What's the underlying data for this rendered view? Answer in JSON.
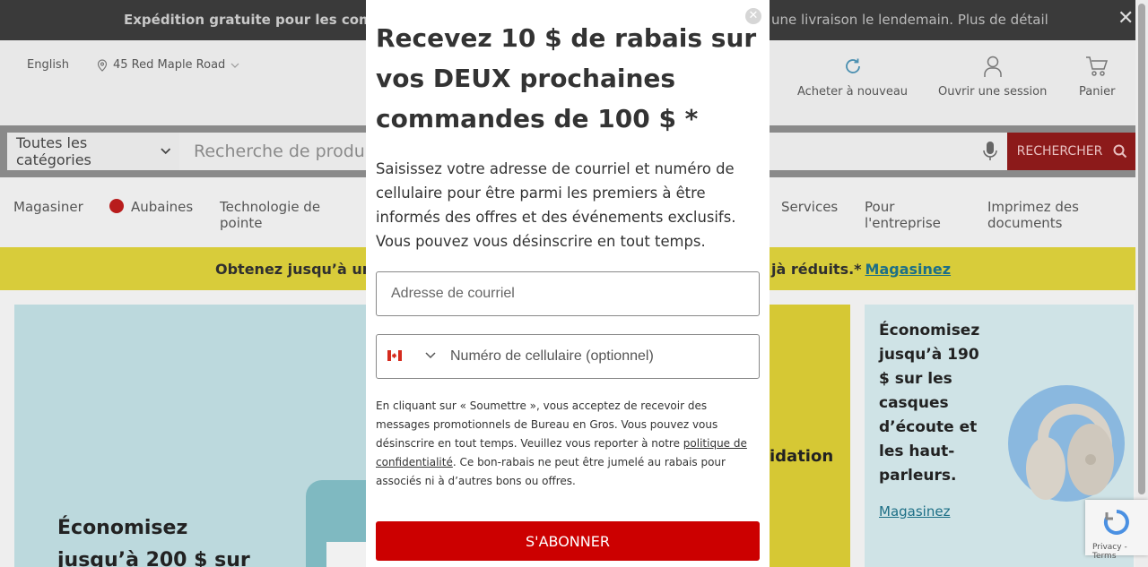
{
  "top_bar": {
    "left_text": "Expédition gratuite pour les comman",
    "right_text": "une livraison le lendemain. Plus de détail",
    "close_icon": "close-icon"
  },
  "header": {
    "language": "English",
    "address": "45 Red Maple Road",
    "reorder_label": "Acheter à nouveau",
    "signin_label": "Ouvrir une session",
    "cart_label": "Panier"
  },
  "search": {
    "category": "Toutes les catégories",
    "placeholder": "Recherche de produits",
    "button_label": "RECHERCHER"
  },
  "nav": {
    "items": [
      "Magasiner",
      "Aubaines",
      "Technologie de pointe",
      "Services",
      "Pour l'entreprise",
      "Imprimez des documents"
    ]
  },
  "promo_bar": {
    "left_text": "Obtenez jusqu’à un ra",
    "right_text": "jà réduits.*",
    "link": "Magasinez"
  },
  "cards": {
    "card1_title": "Économisez jusqu’à 200 $ sur",
    "card2_text": "idation",
    "card3_title": "Économisez jusqu’à 190 $ sur les casques d’écoute et les haut-parleurs.",
    "card3_link": "Magasinez"
  },
  "recaptcha": {
    "label": "Privacy - Terms"
  },
  "modal": {
    "title": "Recevez 10 $ de rabais sur vos DEUX prochaines commandes de 100 $ *",
    "description": "Saisissez votre adresse de courriel et numéro de cellulaire pour être parmi les premiers à être informés des offres et des événements exclusifs. Vous pouvez vous désinscrire en tout temps.",
    "email_placeholder": "Adresse de courriel",
    "phone_placeholder": "Numéro de cellulaire (optionnel)",
    "legal_before": "En cliquant sur « Soumettre », vous acceptez de recevoir des messages promotionnels de Bureau en Gros. Vous pouvez vous désinscrire en tout temps. Veuillez vous reporter à notre ",
    "legal_link": "politique de confidentialité",
    "legal_after": ". Ce bon-rabais ne peut être jumelé au rabais pour associés ni à d’autres bons ou offres.",
    "subscribe_label": "S'ABONNER"
  },
  "colors": {
    "brand_red": "#cc0000",
    "promo_yellow": "#d8cc3a",
    "link_teal": "#1d6f86"
  }
}
